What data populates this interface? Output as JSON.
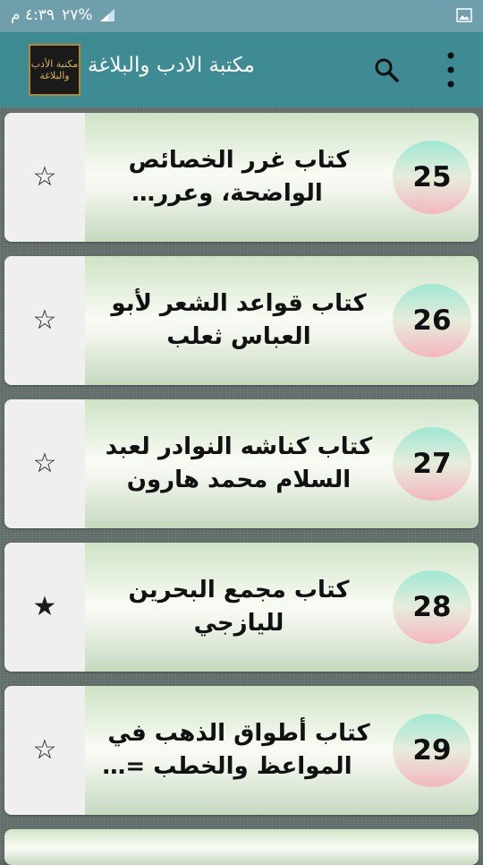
{
  "status": {
    "time": "٤:٣٩ م",
    "battery": "٢٧%"
  },
  "appbar": {
    "title": "مكتبة الادب والبلاغة",
    "logo_text": "مكتبة الأدب والبلاغة"
  },
  "items": [
    {
      "number": "25",
      "title": "كتاب غرر الخصائص الواضحة، وعرر النقائض...",
      "star": "☆",
      "favorite": false
    },
    {
      "number": "26",
      "title": "كتاب قواعد الشعر لأبو العباس ثعلب",
      "star": "☆",
      "favorite": false
    },
    {
      "number": "27",
      "title": "كتاب كناشه النوادر لعبد السلام محمد هارون",
      "star": "☆",
      "favorite": false
    },
    {
      "number": "28",
      "title": "كتاب مجمع البحرين لليازجي",
      "star": "★",
      "favorite": true
    },
    {
      "number": "29",
      "title": "كتاب أطواق الذهب في المواعظ والخطب = كتا...",
      "star": "☆",
      "favorite": false
    }
  ]
}
